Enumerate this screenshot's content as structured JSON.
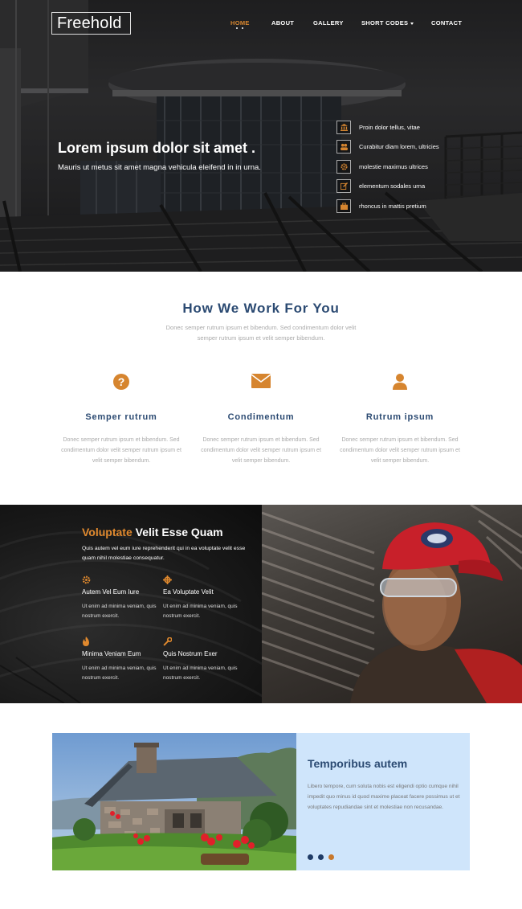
{
  "colors": {
    "accent": "#d6852f",
    "navy": "#2b4a72",
    "panel": "#cfe5fb"
  },
  "logo": "Freehold",
  "nav": [
    {
      "label": "HOME",
      "active": true
    },
    {
      "label": "ABOUT"
    },
    {
      "label": "GALLERY"
    },
    {
      "label": "SHORT CODES",
      "dropdown": true
    },
    {
      "label": "CONTACT"
    }
  ],
  "hero": {
    "title": "Lorem ipsum dolor sit amet .",
    "subtitle": "Mauris ut metus sit amet magna vehicula eleifend in in urna.",
    "features": [
      {
        "icon": "bank-icon",
        "text": "Proin dolor tellus, vitae"
      },
      {
        "icon": "users-icon",
        "text": "Curabitur diam lorem, ultricies"
      },
      {
        "icon": "gear-icon",
        "text": "molestie maximus ultrices"
      },
      {
        "icon": "edit-icon",
        "text": "elementum sodales urna"
      },
      {
        "icon": "briefcase-icon",
        "text": "rhoncus in mattis pretium"
      }
    ]
  },
  "how": {
    "title": "How We Work For You",
    "desc": "Donec semper rutrum ipsum et bibendum. Sed condimentum dolor velit semper rutrum ipsum et velit semper bibendum.",
    "services": [
      {
        "icon": "question-icon",
        "title": "Semper rutrum",
        "desc": "Donec semper rutrum ipsum et bibendum. Sed condimentum dolor velit semper rutrum ipsum et velit semper bibendum."
      },
      {
        "icon": "envelope-icon",
        "title": "Condimentum",
        "desc": "Donec semper rutrum ipsum et bibendum. Sed condimentum dolor velit semper rutrum ipsum et velit semper bibendum."
      },
      {
        "icon": "user-icon",
        "title": "Rutrum ipsum",
        "desc": "Donec semper rutrum ipsum et bibendum. Sed condimentum dolor velit semper rutrum ipsum et velit semper bibendum."
      }
    ]
  },
  "band": {
    "title_accent": "Voluptate",
    "title_rest": " Velit Esse Quam",
    "desc": "Quis autem vel eum iure reprehenderit qui in ea voluptate velit esse quam nihil molestiae consequatur.",
    "features": [
      {
        "icon": "cog-icon",
        "title": "Autem Vel Eum Iure",
        "desc": "Ut enim ad minima veniam, quis nostrum exercit."
      },
      {
        "icon": "crosshair-icon",
        "title": "Ea Voluptate Velit",
        "desc": "Ut enim ad minima veniam, quis nostrum exercit."
      },
      {
        "icon": "fire-icon",
        "title": "Minima Veniam Eum",
        "desc": "Ut enim ad minima veniam, quis nostrum exercit."
      },
      {
        "icon": "wrench-icon",
        "title": "Quis Nostrum Exer",
        "desc": "Ut enim ad minima veniam, quis nostrum exercit."
      }
    ]
  },
  "temporibus": {
    "title": "Temporibus autem",
    "desc": "Libero tempore, cum soluta nobis est eligendi optio cumque nihil impedit quo minus id quod maxime placeat facere possimus ut et voluptates repudiandae sint et molestiae non recusandae.",
    "dot_colors": [
      "#1f3b66",
      "#1f3b66",
      "#c8782c"
    ]
  }
}
